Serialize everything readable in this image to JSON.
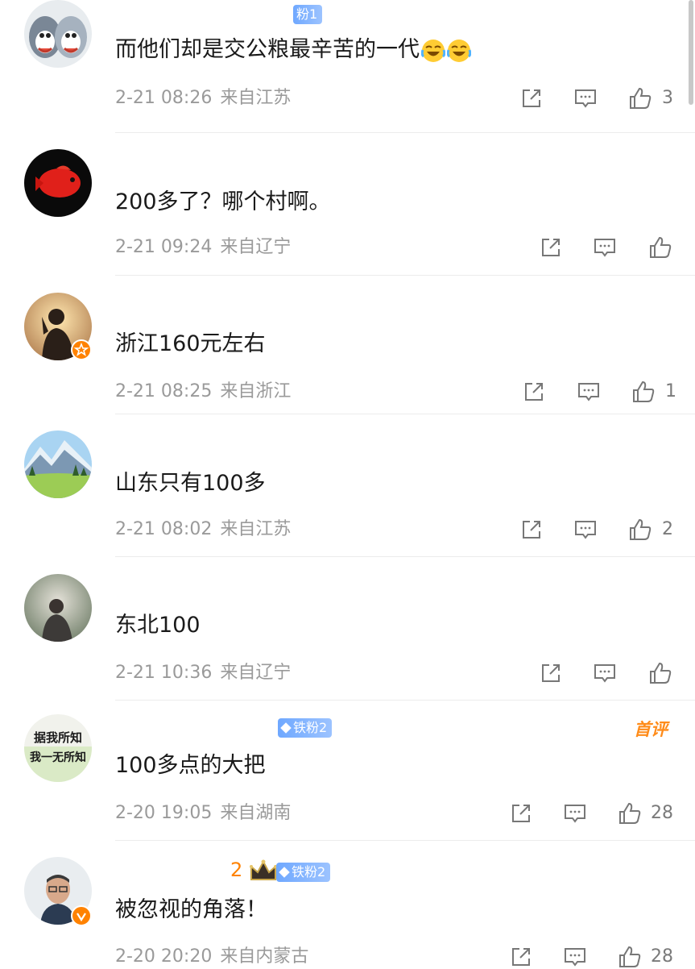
{
  "comments": [
    {
      "id": "c1",
      "username_num": "",
      "fan_badge": "粉1",
      "text": "而他们却是交公粮最辛苦的一代",
      "emoji": [
        "laugh-cry-emoji",
        "laugh-cry-emoji"
      ],
      "date": "2-21 08:26",
      "location": "来自江苏",
      "likes": "3",
      "is_first": false
    },
    {
      "id": "c2",
      "text": "200多了？哪个村啊。",
      "date": "2-21 09:24",
      "location": "来自辽宁",
      "likes": "",
      "is_first": false
    },
    {
      "id": "c3",
      "text": "浙江160元左右",
      "date": "2-21 08:25",
      "location": "来自浙江",
      "likes": "1",
      "is_first": false
    },
    {
      "id": "c4",
      "text": "山东只有100多",
      "date": "2-21 08:02",
      "location": "来自江苏",
      "likes": "2",
      "is_first": false
    },
    {
      "id": "c5",
      "text": "东北100",
      "date": "2-21 10:36",
      "location": "来自辽宁",
      "likes": "",
      "is_first": false
    },
    {
      "id": "c6",
      "fan_badge": "铁粉2",
      "first_tag": "首评",
      "avatar_text_top": "据我所知",
      "avatar_text_bottom": "我一无所知",
      "text": "100多点的大把",
      "date": "2-20 19:05",
      "location": "来自湖南",
      "likes": "28",
      "is_first": true
    },
    {
      "id": "c7",
      "username_num": "2",
      "fan_badge": "铁粉2",
      "text": "被忽视的角落！",
      "date": "2-20 20:20",
      "location": "来自内蒙古",
      "likes": "28",
      "is_first": false
    }
  ],
  "colors": {
    "text": "#1a1a1a",
    "meta": "#9a9a9a",
    "fan_badge": "#7aaeff",
    "first_tag": "#ff8c1a",
    "verified_orange": "#ff8200",
    "divider": "#ececec"
  },
  "icons": {
    "share": "share-icon",
    "comment": "comment-icon",
    "like": "like-icon"
  }
}
